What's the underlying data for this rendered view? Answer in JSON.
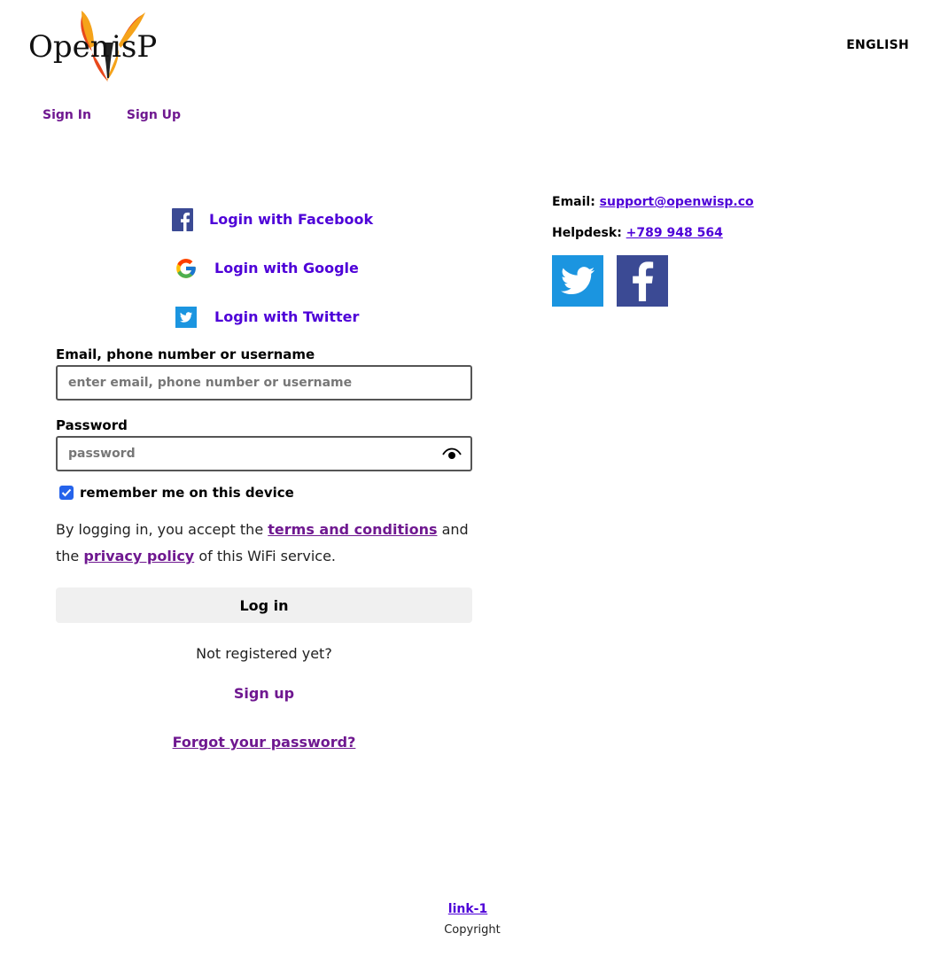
{
  "header": {
    "logo_alt": "OpenWisP",
    "language": "ENGLISH",
    "nav": [
      {
        "label": "Sign In"
      },
      {
        "label": "Sign Up"
      }
    ]
  },
  "social_login": [
    {
      "label": "Login with Facebook",
      "icon": "facebook-icon"
    },
    {
      "label": "Login with Google",
      "icon": "google-icon"
    },
    {
      "label": "Login with Twitter",
      "icon": "twitter-icon"
    }
  ],
  "form": {
    "username_label": "Email, phone number or username",
    "username_placeholder": "enter email, phone number or username",
    "password_label": "Password",
    "password_placeholder": "password",
    "remember_label": "remember me on this device",
    "remember_checked": true,
    "accept_prefix": "By logging in, you accept the",
    "terms_link": "terms and conditions",
    "accept_middle": "and the",
    "privacy_link": "privacy policy",
    "accept_suffix": "of this WiFi service.",
    "login_button": "Log in",
    "not_registered": "Not registered yet?",
    "signup_link": "Sign up",
    "forgot_link": "Forgot your password?"
  },
  "contact": {
    "email_label": "Email:",
    "email_value": "support@openwisp.co",
    "helpdesk_label": "Helpdesk:",
    "helpdesk_value": "+789 948 564"
  },
  "footer": {
    "link": "link-1",
    "copyright": "Copyright"
  },
  "colors": {
    "link_purple": "#6f1890",
    "link_violet": "#4e00d8",
    "twitter_blue": "#1b95e0",
    "facebook_blue": "#3b4a94",
    "checkbox_blue": "#2563eb"
  }
}
